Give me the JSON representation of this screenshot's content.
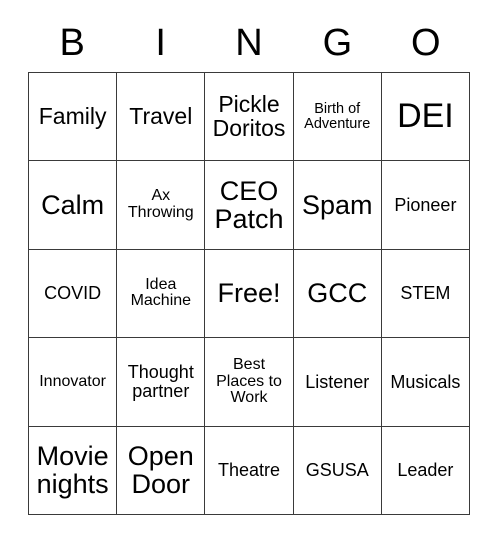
{
  "card": {
    "header_letters": [
      "B",
      "I",
      "N",
      "G",
      "O"
    ],
    "rows": [
      [
        {
          "text": "Family",
          "size": "fs-md"
        },
        {
          "text": "Travel",
          "size": "fs-md"
        },
        {
          "text": "Pickle Doritos",
          "size": "fs-md"
        },
        {
          "text": "Birth of Adventure",
          "size": "fs-xxs"
        },
        {
          "text": "DEI",
          "size": "fs-xl"
        }
      ],
      [
        {
          "text": "Calm",
          "size": "fs-lg"
        },
        {
          "text": "Ax Throwing",
          "size": "fs-xs"
        },
        {
          "text": "CEO Patch",
          "size": "fs-lg"
        },
        {
          "text": "Spam",
          "size": "fs-lg"
        },
        {
          "text": "Pioneer",
          "size": "fs-sm"
        }
      ],
      [
        {
          "text": "COVID",
          "size": "fs-sm"
        },
        {
          "text": "Idea Machine",
          "size": "fs-xs"
        },
        {
          "text": "Free!",
          "size": "fs-lg"
        },
        {
          "text": "GCC",
          "size": "fs-lg"
        },
        {
          "text": "STEM",
          "size": "fs-sm"
        }
      ],
      [
        {
          "text": "Innovator",
          "size": "fs-xs"
        },
        {
          "text": "Thought partner",
          "size": "fs-sm"
        },
        {
          "text": "Best Places to Work",
          "size": "fs-xs"
        },
        {
          "text": "Listener",
          "size": "fs-sm"
        },
        {
          "text": "Musicals",
          "size": "fs-sm"
        }
      ],
      [
        {
          "text": "Movie nights",
          "size": "fs-lg"
        },
        {
          "text": "Open Door",
          "size": "fs-lg"
        },
        {
          "text": "Theatre",
          "size": "fs-sm"
        },
        {
          "text": "GSUSA",
          "size": "fs-sm"
        },
        {
          "text": "Leader",
          "size": "fs-sm"
        }
      ]
    ]
  },
  "colors": {
    "border": "#3a3a3a",
    "text": "#000000",
    "background": "#ffffff"
  }
}
